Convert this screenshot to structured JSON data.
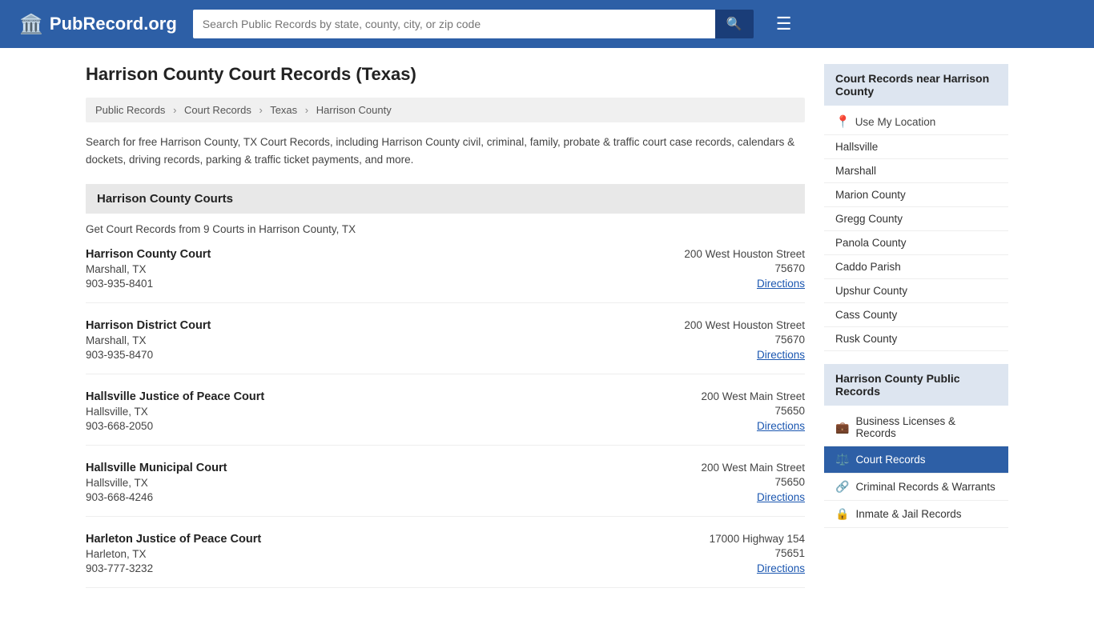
{
  "header": {
    "logo_text": "PubRecord.org",
    "search_placeholder": "Search Public Records by state, county, city, or zip code",
    "search_icon": "🔍",
    "menu_icon": "☰"
  },
  "page": {
    "title": "Harrison County Court Records (Texas)",
    "breadcrumb": [
      {
        "label": "Public Records",
        "href": "#"
      },
      {
        "label": "Court Records",
        "href": "#"
      },
      {
        "label": "Texas",
        "href": "#"
      },
      {
        "label": "Harrison County",
        "href": "#"
      }
    ],
    "description": "Search for free Harrison County, TX Court Records, including Harrison County civil, criminal, family, probate & traffic court case records, calendars & dockets, driving records, parking & traffic ticket payments, and more.",
    "section_title": "Harrison County Courts",
    "courts_subtitle": "Get Court Records from 9 Courts in Harrison County, TX",
    "courts": [
      {
        "name": "Harrison County Court",
        "city": "Marshall, TX",
        "phone": "903-935-8401",
        "street": "200 West Houston Street",
        "zip": "75670",
        "directions": "Directions"
      },
      {
        "name": "Harrison District Court",
        "city": "Marshall, TX",
        "phone": "903-935-8470",
        "street": "200 West Houston Street",
        "zip": "75670",
        "directions": "Directions"
      },
      {
        "name": "Hallsville Justice of Peace Court",
        "city": "Hallsville, TX",
        "phone": "903-668-2050",
        "street": "200 West Main Street",
        "zip": "75650",
        "directions": "Directions"
      },
      {
        "name": "Hallsville Municipal Court",
        "city": "Hallsville, TX",
        "phone": "903-668-4246",
        "street": "200 West Main Street",
        "zip": "75650",
        "directions": "Directions"
      },
      {
        "name": "Harleton Justice of Peace Court",
        "city": "Harleton, TX",
        "phone": "903-777-3232",
        "street": "17000 Highway 154",
        "zip": "75651",
        "directions": "Directions"
      }
    ]
  },
  "sidebar": {
    "nearby_header": "Court Records near Harrison County",
    "use_location": "Use My Location",
    "nearby_items": [
      "Hallsville",
      "Marshall",
      "Marion County",
      "Gregg County",
      "Panola County",
      "Caddo Parish",
      "Upshur County",
      "Cass County",
      "Rusk County"
    ],
    "public_records_header": "Harrison County Public Records",
    "public_records": [
      {
        "label": "Business Licenses & Records",
        "icon": "💼",
        "active": false
      },
      {
        "label": "Court Records",
        "icon": "⚖️",
        "active": true
      },
      {
        "label": "Criminal Records & Warrants",
        "icon": "🔗",
        "active": false
      },
      {
        "label": "Inmate & Jail Records",
        "icon": "🔒",
        "active": false
      }
    ]
  }
}
